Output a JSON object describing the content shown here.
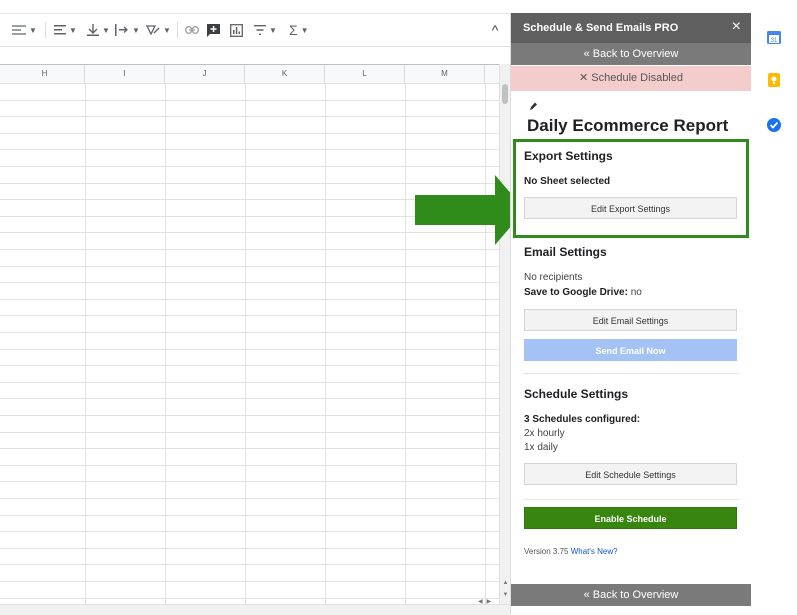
{
  "toolbar": {
    "icons": [
      "wrap-icon",
      "align-left-icon",
      "valign-bottom-icon",
      "text-rotate-icon",
      "text-rotation-icon",
      "link-icon",
      "insert-comment-icon",
      "insert-chart-icon",
      "filter-icon",
      "functions-icon",
      "collapse-icon"
    ],
    "collapse_glyph": "^"
  },
  "grid": {
    "columns": [
      "H",
      "I",
      "J",
      "K",
      "L",
      "M"
    ]
  },
  "sidebar": {
    "title": "Schedule & Send Emails PRO",
    "close_glyph": "×",
    "back_label": "« Back to Overview",
    "disabled_banner": "✕ Schedule Disabled",
    "report_title": "Daily Ecommerce Report",
    "export": {
      "heading": "Export Settings",
      "status": "No Sheet selected",
      "button": "Edit Export Settings"
    },
    "email": {
      "heading": "Email Settings",
      "recipients": "No recipients",
      "drive_label": "Save to Google Drive:",
      "drive_value": "no",
      "edit_button": "Edit Email Settings",
      "send_button": "Send Email Now"
    },
    "schedule": {
      "heading": "Schedule Settings",
      "count": "3 Schedules configured:",
      "items": [
        "2x hourly",
        "1x daily"
      ],
      "edit_button": "Edit Schedule Settings",
      "enable_button": "Enable Schedule"
    },
    "version_text": "Version 3.75",
    "whats_new": "What's New?"
  },
  "colors": {
    "highlight_green": "#2f8c1a",
    "header_gray": "#5f5f5f",
    "disabled_banner": "#f4cccc",
    "enable_button": "#38860f",
    "send_button": "#a4c2f4"
  },
  "side_panel": {
    "icons": [
      "calendar-icon",
      "keep-icon",
      "tasks-icon"
    ],
    "calendar_label": "31"
  }
}
